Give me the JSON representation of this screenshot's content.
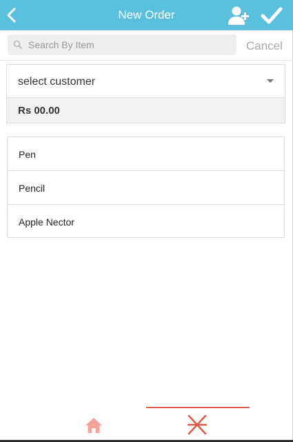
{
  "header": {
    "title": "New Order",
    "back_icon": "chevron-left-icon",
    "add_user_icon": "add-user-icon",
    "confirm_icon": "checkmark-icon",
    "background_color": "#5bc0de"
  },
  "search": {
    "placeholder": "Search By Item",
    "value": "",
    "cancel_label": "Cancel"
  },
  "customer": {
    "select_label": "select customer",
    "total": "Rs 00.00"
  },
  "items": [
    {
      "name": "Pen"
    },
    {
      "name": "Pencil"
    },
    {
      "name": "Apple Nector"
    }
  ],
  "bottom_nav": {
    "tabs": [
      {
        "icon": "home-icon",
        "active": false
      },
      {
        "icon": "asterisk-icon",
        "active": true
      }
    ],
    "accent_color": "#e05a4a"
  }
}
